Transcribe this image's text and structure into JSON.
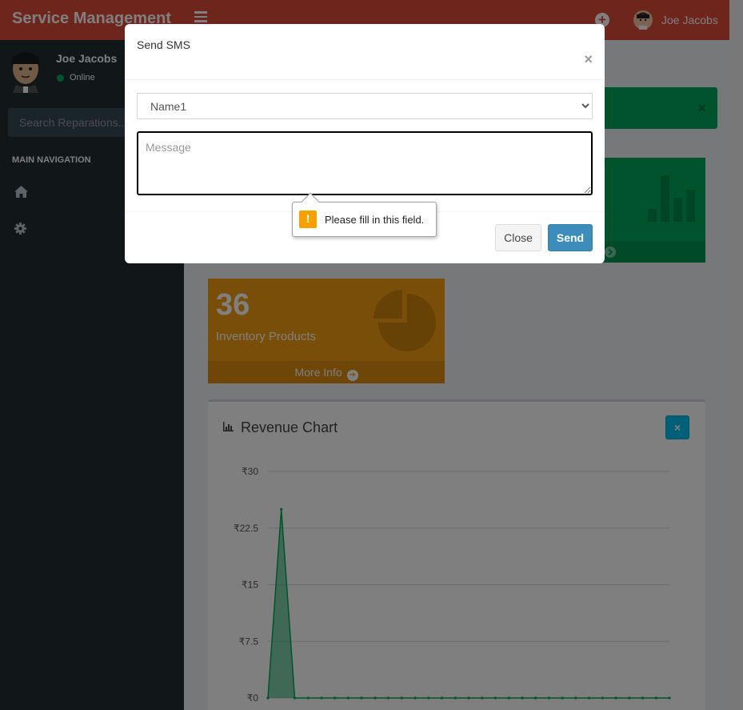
{
  "header": {
    "brand": "Service Management",
    "username": "Joe Jacobs"
  },
  "sidebar": {
    "username": "Joe Jacobs",
    "status": "Online",
    "search_placeholder": "Search Reparations...",
    "nav_header": "MAIN NAVIGATION",
    "items": [
      {
        "icon": "home-icon"
      },
      {
        "icon": "gear-icon"
      }
    ]
  },
  "dashboard": {
    "inventory": {
      "count": "36",
      "label": "Inventory Products",
      "more": "More Info"
    },
    "chart_box_title": "Revenue Chart"
  },
  "modal": {
    "title": "Send SMS",
    "close_x": "×",
    "select_value": "Name1",
    "select_options": [
      "Name1"
    ],
    "message_placeholder": "Message",
    "close_label": "Close",
    "send_label": "Send"
  },
  "tooltip": {
    "text": "Please fill in this field.",
    "icon": "!"
  },
  "colors": {
    "header": "#dd4b39",
    "sidebar": "#222d32",
    "green": "#00a65a",
    "orange": "#f39c12",
    "info": "#00c0ef",
    "primary": "#3c8dbc"
  },
  "chart_data": {
    "type": "area",
    "title": "",
    "xlabel": "",
    "ylabel": "",
    "ylim": [
      0,
      30
    ],
    "yticks": [
      "₹30",
      "₹22.5",
      "₹15",
      "₹7.5",
      "₹0"
    ],
    "ytick_values": [
      30,
      22.5,
      15,
      7.5,
      0
    ],
    "x": [
      0,
      1,
      2,
      3,
      4,
      5,
      6,
      7,
      8,
      9,
      10,
      11,
      12,
      13,
      14,
      15,
      16,
      17,
      18,
      19,
      20,
      21,
      22,
      23,
      24,
      25,
      26,
      27,
      28,
      29,
      30
    ],
    "series": [
      {
        "values": [
          0,
          25,
          0,
          0,
          0,
          0,
          0,
          0,
          0,
          0,
          0,
          0,
          0,
          0,
          0,
          0,
          0,
          0,
          0,
          0,
          0,
          0,
          0,
          0,
          0,
          0,
          0,
          0,
          0,
          0,
          0
        ]
      }
    ],
    "grid": true,
    "color": "#00a65a"
  }
}
